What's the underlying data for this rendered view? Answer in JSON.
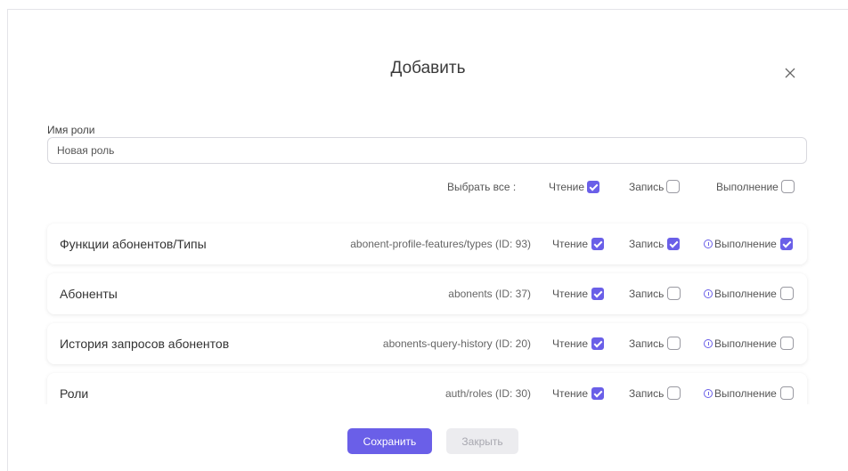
{
  "dialog": {
    "title": "Добавить",
    "close_icon": "close-icon"
  },
  "role_name": {
    "label": "Имя роли",
    "placeholder": "Новая роль",
    "value": ""
  },
  "select_all": {
    "label": "Выбрать все :",
    "read_label": "Чтение",
    "read_checked": true,
    "write_label": "Запись",
    "write_checked": false,
    "execute_label": "Выполнение",
    "execute_checked": false
  },
  "permissions": [
    {
      "name": "Функции абонентов/Типы",
      "path": "abonent-profile-features/types (ID: 93)",
      "read_label": "Чтение",
      "read_checked": true,
      "write_label": "Запись",
      "write_checked": true,
      "execute_label": "Выполнение",
      "execute_checked": true
    },
    {
      "name": "Абоненты",
      "path": "abonents (ID: 37)",
      "read_label": "Чтение",
      "read_checked": true,
      "write_label": "Запись",
      "write_checked": false,
      "execute_label": "Выполнение",
      "execute_checked": false
    },
    {
      "name": "История запросов абонентов",
      "path": "abonents-query-history (ID: 20)",
      "read_label": "Чтение",
      "read_checked": true,
      "write_label": "Запись",
      "write_checked": false,
      "execute_label": "Выполнение",
      "execute_checked": false
    },
    {
      "name": "Роли",
      "path": "auth/roles (ID: 30)",
      "read_label": "Чтение",
      "read_checked": true,
      "write_label": "Запись",
      "write_checked": false,
      "execute_label": "Выполнение",
      "execute_checked": false
    }
  ],
  "footer": {
    "save_label": "Сохранить",
    "close_label": "Закрыть"
  },
  "colors": {
    "accent": "#6a5fe8",
    "disabled_bg": "#ececef"
  }
}
